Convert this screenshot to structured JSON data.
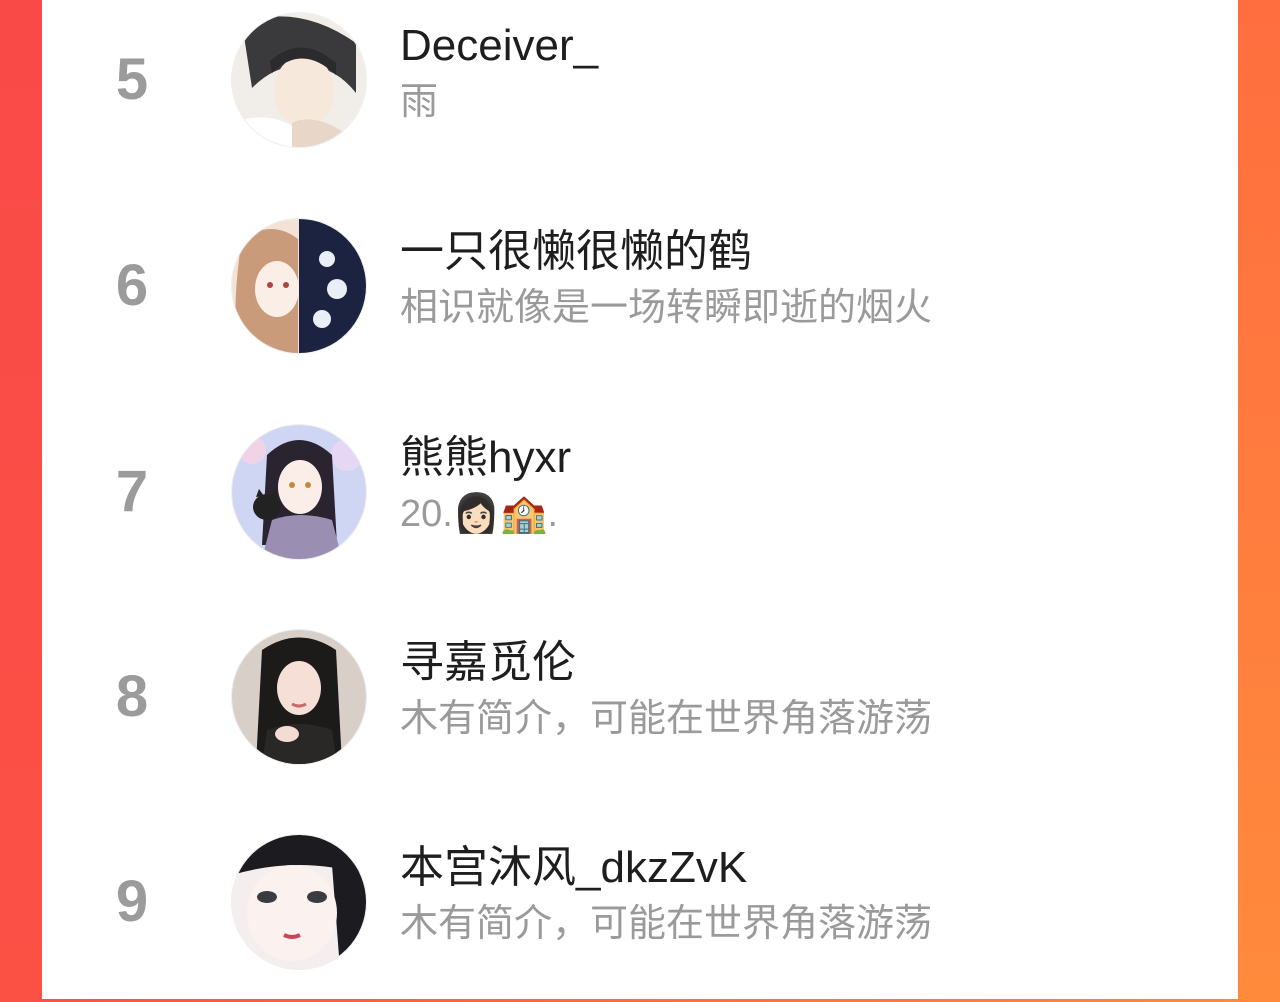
{
  "ranking": {
    "rows": [
      {
        "rank": "5",
        "name": "Deceiver_",
        "bio": "雨"
      },
      {
        "rank": "6",
        "name": "一只很懒很懒的鹤",
        "bio": "相识就像是一场转瞬即逝的烟火"
      },
      {
        "rank": "7",
        "name": "熊熊hyxr",
        "bio": "20.👩🏻🏫."
      },
      {
        "rank": "8",
        "name": "寻嘉觅伦",
        "bio": "木有简介，可能在世界角落游荡"
      },
      {
        "rank": "9",
        "name": "本宫沐风_dkzZvK",
        "bio": "木有简介，可能在世界角落游荡"
      }
    ]
  },
  "colors": {
    "background_left": "#fa4a48",
    "background_right": "#ff8a3c",
    "card": "#ffffff",
    "rank_text": "#9b9b9b",
    "name_text": "#1e1e1e",
    "bio_text": "#9a9a9a"
  }
}
